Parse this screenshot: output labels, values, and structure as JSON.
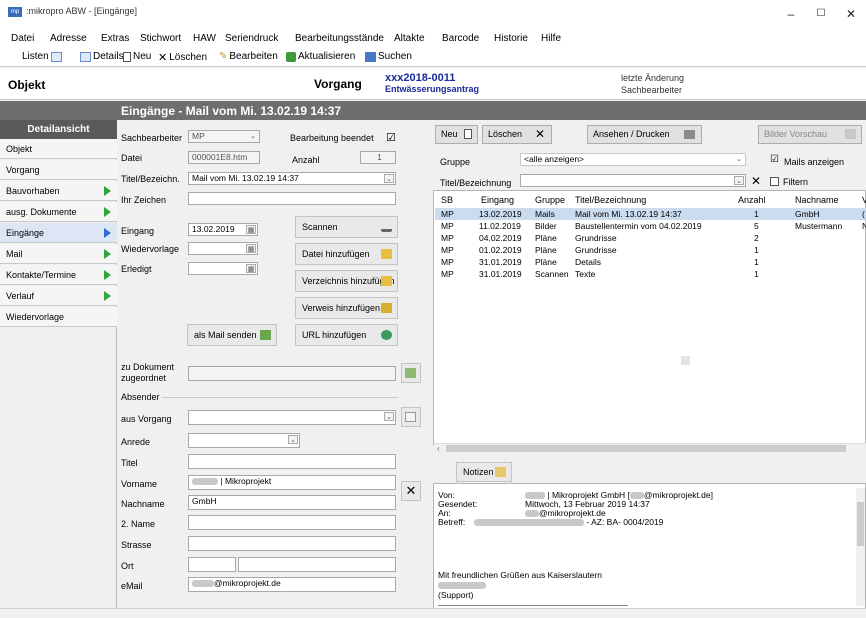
{
  "window": {
    "app_icon": "mp",
    "title": ":mikropro ABW - [Eingänge]",
    "controls": {
      "minimize": "–",
      "maximize": "☐",
      "close": "✕"
    }
  },
  "menu": [
    "Datei",
    "Adresse",
    "Extras",
    "Stichwort",
    "HAW",
    "Seriendruck",
    "Bearbeitungsstände",
    "Altakte",
    "Barcode",
    "Historie",
    "Hilfe"
  ],
  "toolbar": {
    "listen": "Listen",
    "details": "Details",
    "neu": "Neu",
    "loeschen": "Löschen",
    "bearbeiten": "Bearbeiten",
    "aktualisieren": "Aktualisieren",
    "suchen": "Suchen"
  },
  "header": {
    "objekt": "Objekt",
    "vorgang": "Vorgang",
    "vorgang_nummer": "xxx2018-0011",
    "vorgang_bezeichnung": "Entwässerungsantrag",
    "letzte_aenderung": "letzte Änderung",
    "sachbearbeiter": "Sachbearbeiter"
  },
  "band_title": "Eingänge - Mail vom Mi. 13.02.19 14:37",
  "sidebar": {
    "heading": "Detailansicht",
    "items": [
      {
        "label": "Objekt",
        "arrow": false
      },
      {
        "label": "Vorgang",
        "arrow": false
      },
      {
        "label": "Bauvorhaben",
        "arrow": true
      },
      {
        "label": "ausg. Dokumente",
        "arrow": true
      },
      {
        "label": "Eingänge",
        "arrow": true,
        "active": true
      },
      {
        "label": "Mail",
        "arrow": true
      },
      {
        "label": "Kontakte/Termine",
        "arrow": true
      },
      {
        "label": "Verlauf",
        "arrow": true
      },
      {
        "label": "Wiedervorlage",
        "arrow": false
      }
    ]
  },
  "form": {
    "sachbearbeiter_label": "Sachbearbeiter",
    "sachbearbeiter_value": "MP",
    "bearbeitung_beendet_label": "Bearbeitung beendet",
    "bearbeitung_beendet_checked": "☑",
    "datei_label": "Datei",
    "datei_value": "000001E8.htm",
    "anzahl_label": "Anzahl",
    "anzahl_value": "1",
    "titel_label": "Titel/Bezeichn.",
    "titel_value": "Mail vom Mi. 13.02.19 14:37",
    "ihr_zeichen_label": "Ihr Zeichen",
    "eingang_label": "Eingang",
    "eingang_value": "13.02.2019",
    "wiedervorlage_label": "Wiedervorlage",
    "erledigt_label": "Erledigt",
    "scannen": "Scannen",
    "datei_hinzufuegen": "Datei hinzufügen",
    "verzeichnis_hinzufuegen": "Verzeichnis hinzufügen",
    "verweis_hinzufuegen": "Verweis hinzufügen",
    "als_mail_senden": "als Mail senden",
    "url_hinzufuegen": "URL hinzufügen",
    "zu_dokument_label": "zu Dokument zugeordnet",
    "absender_label": "Absender",
    "aus_vorgang_label": "aus Vorgang",
    "anrede_label": "Anrede",
    "titel2_label": "Titel",
    "vorname_label": "Vorname",
    "vorname_value": "| Mikroprojekt",
    "nachname_label": "Nachname",
    "nachname_value": "GmbH",
    "name2_label": "2. Name",
    "strasse_label": "Strasse",
    "ort_label": "Ort",
    "email_label": "eMail",
    "email_value": "@mikroprojekt.de"
  },
  "right": {
    "neu": "Neu",
    "loeschen": "Löschen",
    "ansehen_drucken": "Ansehen / Drucken",
    "bilder_vorschau": "Bilder Vorschau",
    "gruppe_label": "Gruppe",
    "gruppe_value": "<alle anzeigen>",
    "mails_anzeigen_label": "Mails anzeigen",
    "titel_filter_label": "Titel/Bezeichnung",
    "filtern_label": "Filtern"
  },
  "grid": {
    "columns": [
      "SB",
      "Eingang",
      "Gruppe",
      "Titel/Bezeichnung",
      "Anzahl",
      "Nachname",
      "V"
    ],
    "rows": [
      [
        "MP",
        "13.02.2019",
        "Mails",
        "Mail vom Mi. 13.02.19 14:37",
        "1",
        "GmbH",
        "("
      ],
      [
        "MP",
        "11.02.2019",
        "Bilder",
        "Baustellentermin vom 04.02.2019",
        "5",
        "Mustermann",
        "N"
      ],
      [
        "MP",
        "04.02.2019",
        "Pläne",
        "Grundrisse",
        "2",
        "",
        ""
      ],
      [
        "MP",
        "01.02.2019",
        "Pläne",
        "Grundrisse",
        "1",
        "",
        ""
      ],
      [
        "MP",
        "31.01.2019",
        "Pläne",
        "Details",
        "1",
        "",
        ""
      ],
      [
        "MP",
        "31.01.2019",
        "Scannen",
        "Texte",
        "1",
        "",
        ""
      ]
    ]
  },
  "notes": {
    "button": "Notizen",
    "von_label": "Von:",
    "von_value": "| Mikroprojekt GmbH [",
    "von_value_end": "@mikroprojekt.de]",
    "gesendet_label": "Gesendet:",
    "gesendet_value": "Mittwoch, 13 Februar 2019 14:37",
    "an_label": "An:",
    "an_value": "@mikroprojekt.de",
    "betreff_label": "Betreff:",
    "betreff_value": "- AZ: BA- 0004/2019",
    "gruss": "Mit freundlichen Grüßen aus Kaiserslautern",
    "support": "(Support)"
  }
}
